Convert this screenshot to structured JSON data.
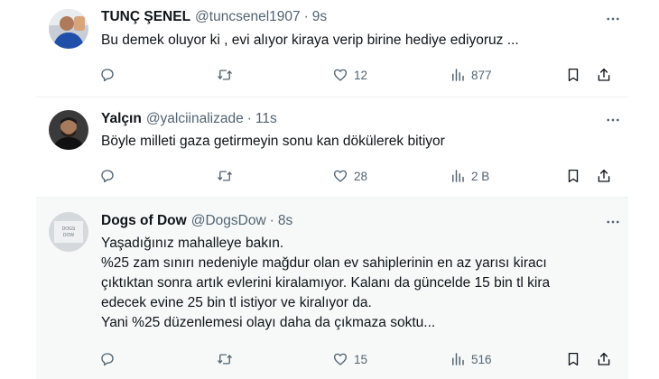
{
  "tweets": [
    {
      "name": "TUNÇ ŞENEL",
      "handle": "@tuncsenel1907",
      "separator": "·",
      "time": "9s",
      "text_lines": [
        "Bu demek oluyor ki , evi alıyor kiraya verip birine hediye ediyoruz ..."
      ],
      "replies": "",
      "retweets": "",
      "likes": "12",
      "views": "877"
    },
    {
      "name": "Yalçın",
      "handle": "@yalciinalizade",
      "separator": "·",
      "time": "11s",
      "text_lines": [
        "Böyle milleti gaza getirmeyin sonu kan dökülerek bitiyor"
      ],
      "replies": "",
      "retweets": "",
      "likes": "28",
      "views": "2 B"
    },
    {
      "name": "Dogs of Dow",
      "handle": "@DogsDow",
      "separator": "·",
      "time": "8s",
      "text_lines": [
        "Yaşadığınız mahalleye bakın.",
        "%25 zam sınırı nedeniyle mağdur olan ev sahiplerinin en az yarısı kiracı",
        "çıktıktan sonra artık evlerini kiralamıyor. Kalanı da güncelde 15 bin tl kira",
        "edecek evine 25 bin tl istiyor ve kiralıyor da.",
        "Yani %25 düzenlemesi olayı daha da çıkmaza soktu..."
      ],
      "replies": "",
      "retweets": "",
      "likes": "15",
      "views": "516"
    }
  ],
  "colors": {
    "text": "#0f1419",
    "secondary": "#536471",
    "divider": "#eff3f4",
    "highlight_bg": "#f7f9f9"
  },
  "icons": [
    "reply-icon",
    "retweet-icon",
    "like-icon",
    "views-icon",
    "bookmark-icon",
    "share-icon",
    "more-icon"
  ]
}
